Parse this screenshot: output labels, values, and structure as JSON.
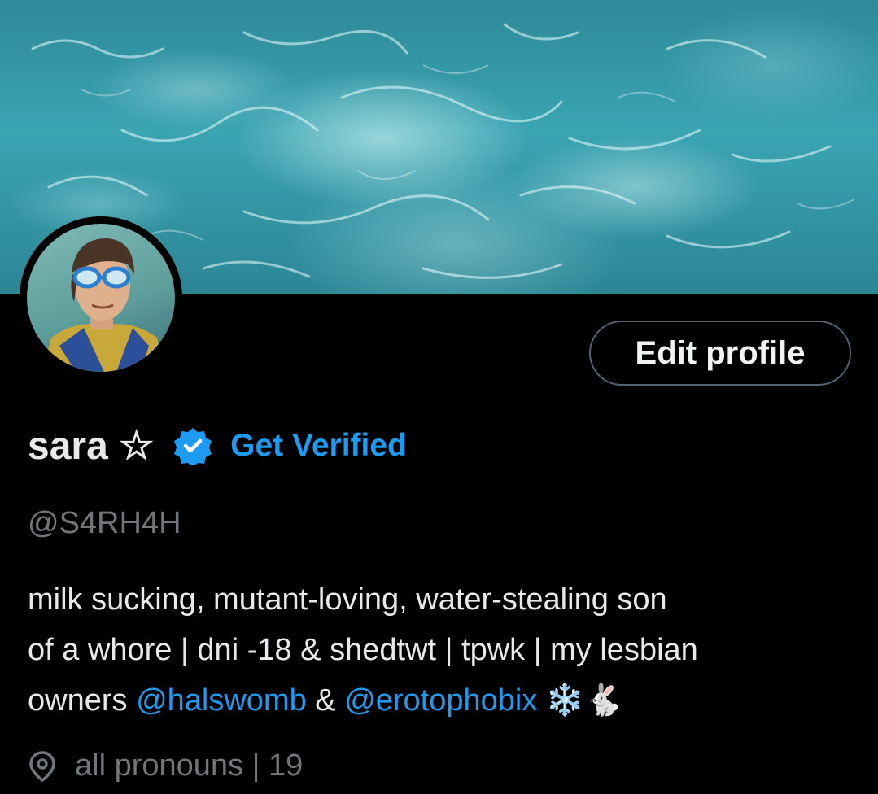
{
  "header": {
    "banner_image": "ocean-water-banner"
  },
  "profile": {
    "avatar": "cartoon-character-with-goggles",
    "display_name": "sara ☆",
    "verified_badge_icon": "verified-badge-icon",
    "get_verified_label": "Get Verified",
    "handle": "@S4RH4H",
    "edit_profile_label": "Edit profile",
    "bio": {
      "line1": "milk sucking, mutant-loving, water-stealing son",
      "line2": "of a whore | dni -18 & shedtwt | tpwk | my lesbian",
      "line3_prefix": "owners ",
      "mention1": "@halswomb",
      "line3_mid": " & ",
      "mention2": "@erotophobix",
      "emoji_snowflake": "❄️",
      "emoji_rabbit": "🐇"
    },
    "location_icon": "location-pin-icon",
    "location": "all pronouns | 19"
  },
  "colors": {
    "accent": "#1d9bf0",
    "background": "#000000",
    "muted": "#71767b",
    "border": "#536471"
  }
}
